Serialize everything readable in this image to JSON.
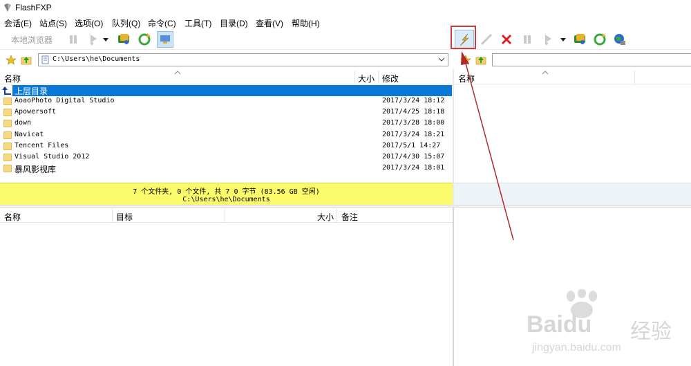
{
  "window": {
    "title": "FlashFXP"
  },
  "menu": [
    "会话(E)",
    "站点(S)",
    "选项(O)",
    "队列(Q)",
    "命令(C)",
    "工具(T)",
    "目录(D)",
    "查看(V)",
    "帮助(H)"
  ],
  "toolbar": {
    "local_browser_label": "本地浏览器"
  },
  "left_pane": {
    "path": "C:\\Users\\he\\Documents",
    "columns": {
      "name": "名称",
      "size": "大小",
      "modified": "修改"
    },
    "parent_dir_label": "上层目录",
    "files": [
      {
        "name": "AoaoPhoto Digital Studio",
        "modified": "2017/3/24 18:12"
      },
      {
        "name": "Apowersoft",
        "modified": "2017/4/25 18:18"
      },
      {
        "name": "down",
        "modified": "2017/3/28 18:00"
      },
      {
        "name": "Navicat",
        "modified": "2017/3/24 18:21"
      },
      {
        "name": "Tencent Files",
        "modified": "2017/5/1 14:27"
      },
      {
        "name": "Visual Studio 2012",
        "modified": "2017/4/30 15:07"
      },
      {
        "name": "暴风影视库",
        "modified": "2017/3/24 18:01"
      }
    ],
    "status_line1": "7 个文件夹, 0 个文件, 共 7 0 字节 (83.56 GB 空闲)",
    "status_line2": "C:\\Users\\he\\Documents"
  },
  "right_pane": {
    "path": "",
    "columns": {
      "name": "名称"
    }
  },
  "queue": {
    "columns": {
      "name": "名称",
      "target": "目标",
      "size": "大小",
      "note": "备注"
    }
  },
  "watermark": {
    "brand": "Baidu",
    "cn": "经验",
    "url": "jingyan.baidu.com"
  },
  "colors": {
    "selection": "#0a78d7",
    "status_bg": "#fafa6a",
    "annotation": "#d23a3a"
  }
}
